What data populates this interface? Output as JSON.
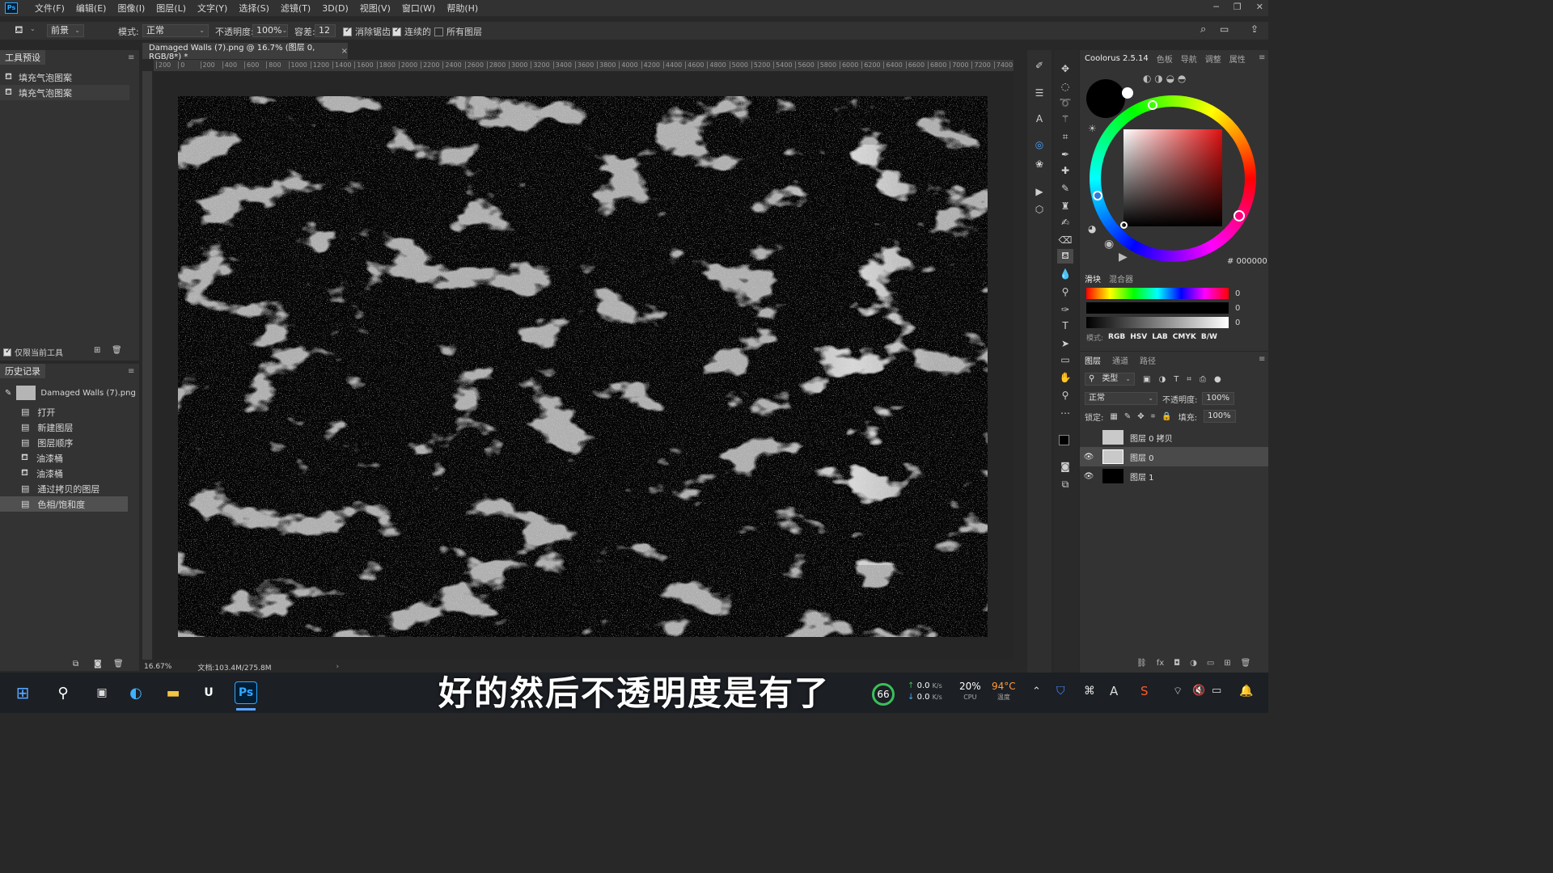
{
  "menubar": {
    "logo": "Ps",
    "items": [
      "文件(F)",
      "编辑(E)",
      "图像(I)",
      "图层(L)",
      "文字(Y)",
      "选择(S)",
      "滤镜(T)",
      "3D(D)",
      "视图(V)",
      "窗口(W)",
      "帮助(H)"
    ]
  },
  "optbar": {
    "fill_source": "前景",
    "mode_label": "模式:",
    "mode_value": "正常",
    "opacity_label": "不透明度:",
    "opacity_value": "100%",
    "tolerance_label": "容差:",
    "tolerance_value": "12",
    "antialias_label": "消除锯齿",
    "contiguous_label": "连续的",
    "all_layers_label": "所有图层"
  },
  "tool_presets": {
    "title": "工具预设",
    "items": [
      "填充气泡图案",
      "填充气泡图案"
    ],
    "current_tool_only": "仅限当前工具"
  },
  "history": {
    "title": "历史记录",
    "snapshot": "Damaged Walls (7).png",
    "items": [
      "打开",
      "新建图层",
      "图层顺序",
      "油漆桶",
      "油漆桶",
      "通过拷贝的图层",
      "色相/饱和度"
    ]
  },
  "document": {
    "tab_title": "Damaged Walls (7).png @ 16.7% (图层 0, RGB/8*) *",
    "ruler_ticks": [
      "200",
      "0",
      "200",
      "400",
      "600",
      "800",
      "1000",
      "1200",
      "1400",
      "1600",
      "1800",
      "2000",
      "2200",
      "2400",
      "2600",
      "2800",
      "3000",
      "3200",
      "3400",
      "3600",
      "3800",
      "4000",
      "4200",
      "4400",
      "4600",
      "4800",
      "5000",
      "5200",
      "5400",
      "5600",
      "5800",
      "6000",
      "6200",
      "6400",
      "6600",
      "6800",
      "7000",
      "7200",
      "7400"
    ],
    "zoom": "16.67%",
    "doc_size": "文档:103.4M/275.8M"
  },
  "right_panel": {
    "top_tabs": [
      "Coolorus 2.5.14",
      "色板",
      "导航",
      "调整",
      "属性"
    ],
    "hex_value": "# 000000",
    "slider_tabs": [
      "滑块",
      "混合器"
    ],
    "slider_values": [
      "0",
      "0",
      "0"
    ],
    "mode_label": "模式:",
    "modes": [
      "RGB",
      "HSV",
      "LAB",
      "CMYK",
      "B/W"
    ],
    "layer_tabs": [
      "图层",
      "通道",
      "路径"
    ],
    "kind_filter": "类型",
    "blend_mode": "正常",
    "opacity_label": "不透明度:",
    "opacity_value": "100%",
    "lock_label": "锁定:",
    "fill_label": "填充:",
    "fill_value": "100%",
    "layers": [
      {
        "name": "图层 0 拷贝",
        "visible": false
      },
      {
        "name": "图层 0",
        "visible": true
      },
      {
        "name": "图层 1",
        "visible": true
      }
    ]
  },
  "subtitle": "好的然后不透明度是有了",
  "taskbar": {
    "badge": "66",
    "net_up": "0.0",
    "net_down": "0.0",
    "net_unit": "K/s",
    "cpu_value": "20%",
    "cpu_label": "CPU",
    "temp_value": "94°C",
    "temp_label": "温度"
  },
  "colors": {
    "accent": "#31a8ff",
    "app_bg": "#282828",
    "panel_bg": "#333333",
    "temp_warning": "#ff9a3c"
  }
}
